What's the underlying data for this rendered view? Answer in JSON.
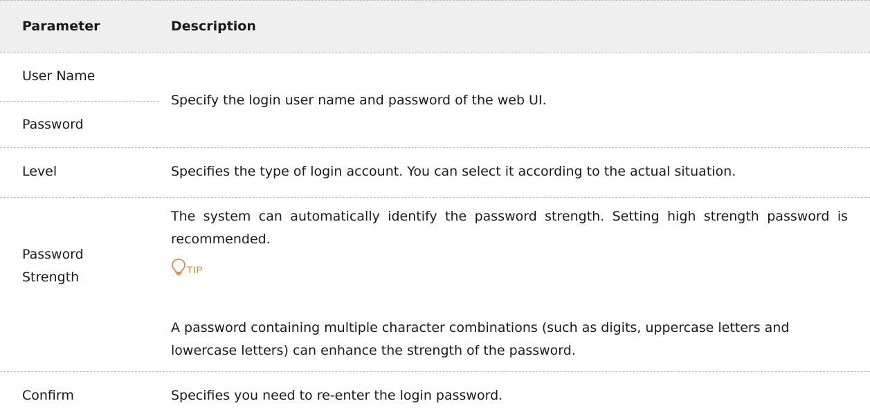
{
  "table": {
    "header": {
      "parameter": "Parameter",
      "description": "Description"
    },
    "rows": {
      "user_name": {
        "parameter": "User Name"
      },
      "password": {
        "parameter": "Password",
        "description": "Specify the login user name and password of the web UI."
      },
      "level": {
        "parameter": "Level",
        "description": "Specifies the type of login account. You can select it according to the actual situation."
      },
      "password_strength": {
        "parameter_line1": "Password",
        "parameter_line2": "Strength",
        "description": "The system can automatically identify the password strength. Setting high strength password is recommended.",
        "tip_label": "TIP",
        "tip_icon": "lightbulb-icon",
        "tip_text": "A password containing multiple character combinations (such as digits, uppercase letters and lowercase letters) can enhance the strength of the password."
      },
      "confirm": {
        "parameter": "Confirm",
        "description": "Specifies you need to re-enter the login password."
      }
    }
  },
  "colors": {
    "header_background": "#efefef",
    "tip_accent": "#f07a2a",
    "rule": "#b7b7b7"
  }
}
